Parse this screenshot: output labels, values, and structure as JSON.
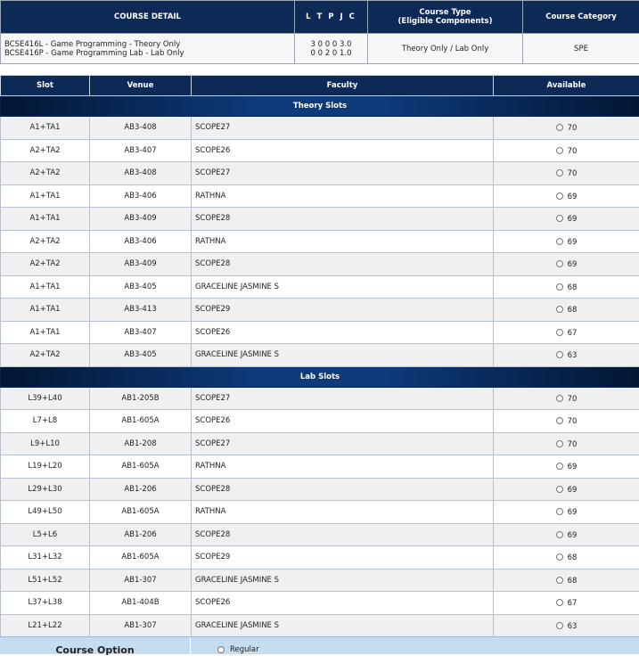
{
  "course_table": {
    "headers": {
      "course_detail": "COURSE DETAIL",
      "ltpjc": "L T P J C",
      "course_type_line1": "Course Type",
      "course_type_line2": "(Eligible Components)",
      "course_category": "Course Category"
    },
    "row": {
      "course_line1": "BCSE416L - Game Programming - Theory Only",
      "course_line2": "BCSE416P - Game Programming Lab - Lab Only",
      "ltpjc_line1": "3 0 0 0 3.0",
      "ltpjc_line2": "0 0 2 0 1.0",
      "course_type": "Theory Only / Lab Only",
      "course_category": "SPE"
    }
  },
  "slot_table": {
    "headers": {
      "slot": "Slot",
      "venue": "Venue",
      "faculty": "Faculty",
      "available": "Available"
    },
    "sections": [
      {
        "title": "Theory Slots",
        "rows": [
          {
            "slot": "A1+TA1",
            "venue": "AB3-408",
            "faculty": "SCOPE27",
            "available": "70"
          },
          {
            "slot": "A2+TA2",
            "venue": "AB3-407",
            "faculty": "SCOPE26",
            "available": "70"
          },
          {
            "slot": "A2+TA2",
            "venue": "AB3-408",
            "faculty": "SCOPE27",
            "available": "70"
          },
          {
            "slot": "A1+TA1",
            "venue": "AB3-406",
            "faculty": "RATHNA",
            "available": "69"
          },
          {
            "slot": "A1+TA1",
            "venue": "AB3-409",
            "faculty": "SCOPE28",
            "available": "69"
          },
          {
            "slot": "A2+TA2",
            "venue": "AB3-406",
            "faculty": "RATHNA",
            "available": "69"
          },
          {
            "slot": "A2+TA2",
            "venue": "AB3-409",
            "faculty": "SCOPE28",
            "available": "69"
          },
          {
            "slot": "A1+TA1",
            "venue": "AB3-405",
            "faculty": "GRACELINE JASMINE S",
            "available": "68"
          },
          {
            "slot": "A1+TA1",
            "venue": "AB3-413",
            "faculty": "SCOPE29",
            "available": "68"
          },
          {
            "slot": "A1+TA1",
            "venue": "AB3-407",
            "faculty": "SCOPE26",
            "available": "67"
          },
          {
            "slot": "A2+TA2",
            "venue": "AB3-405",
            "faculty": "GRACELINE JASMINE S",
            "available": "63"
          }
        ]
      },
      {
        "title": "Lab Slots",
        "rows": [
          {
            "slot": "L39+L40",
            "venue": "AB1-205B",
            "faculty": "SCOPE27",
            "available": "70"
          },
          {
            "slot": "L7+L8",
            "venue": "AB1-605A",
            "faculty": "SCOPE26",
            "available": "70"
          },
          {
            "slot": "L9+L10",
            "venue": "AB1-208",
            "faculty": "SCOPE27",
            "available": "70"
          },
          {
            "slot": "L19+L20",
            "venue": "AB1-605A",
            "faculty": "RATHNA",
            "available": "69"
          },
          {
            "slot": "L29+L30",
            "venue": "AB1-206",
            "faculty": "SCOPE28",
            "available": "69"
          },
          {
            "slot": "L49+L50",
            "venue": "AB1-605A",
            "faculty": "RATHNA",
            "available": "69"
          },
          {
            "slot": "L5+L6",
            "venue": "AB1-206",
            "faculty": "SCOPE28",
            "available": "69"
          },
          {
            "slot": "L31+L32",
            "venue": "AB1-605A",
            "faculty": "SCOPE29",
            "available": "68"
          },
          {
            "slot": "L51+L52",
            "venue": "AB1-307",
            "faculty": "GRACELINE JASMINE S",
            "available": "68"
          },
          {
            "slot": "L37+L38",
            "venue": "AB1-404B",
            "faculty": "SCOPE26",
            "available": "67"
          },
          {
            "slot": "L21+L22",
            "venue": "AB1-307",
            "faculty": "GRACELINE JASMINE S",
            "available": "63"
          }
        ]
      }
    ]
  },
  "course_option": {
    "label": "Course Option",
    "regular_label": "Regular"
  },
  "colors": {
    "header_bg": "#0d2a57",
    "section_bg": "#0d3a7a",
    "option_bar_bg": "#c6ddf0"
  }
}
